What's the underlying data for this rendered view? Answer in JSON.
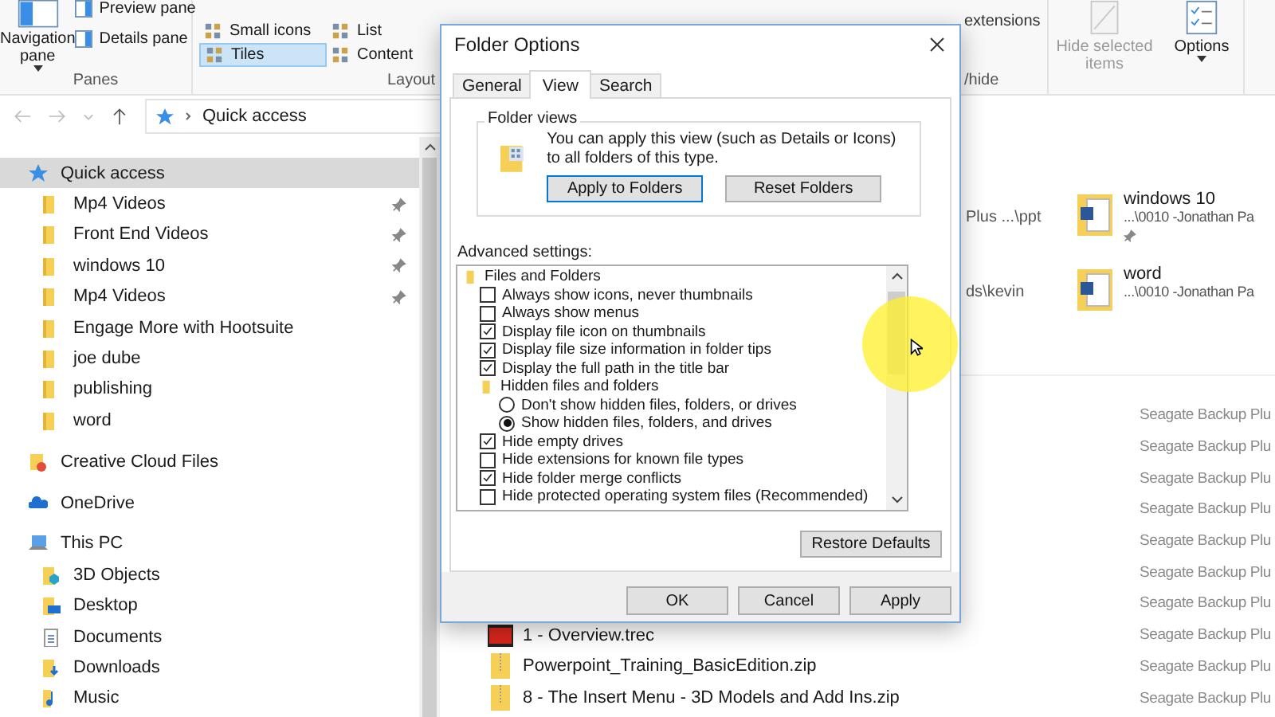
{
  "ribbon": {
    "panes": {
      "label": "Panes",
      "navigation": "Navigation pane",
      "buttons": [
        "Preview pane",
        "Details pane"
      ]
    },
    "layout": {
      "label": "Layout",
      "options": [
        {
          "label": "Small icons",
          "selected": false
        },
        {
          "label": "Tiles",
          "selected": true
        },
        {
          "label": "List",
          "selected": false
        },
        {
          "label": "Content",
          "selected": false
        }
      ]
    },
    "show_hide": {
      "label": "/hide",
      "option": "extensions"
    },
    "hide_selected": "Hide selected items",
    "options": "Options"
  },
  "address": {
    "location": "Quick access"
  },
  "sidebar": {
    "items": [
      {
        "label": "Quick access",
        "kind": "star",
        "selected": true,
        "pinned": false,
        "children": [
          {
            "label": "Mp4 Videos",
            "kind": "folder",
            "selected": false,
            "pinned": true
          },
          {
            "label": "Front End Videos",
            "kind": "folder",
            "selected": false,
            "pinned": true
          },
          {
            "label": "windows 10",
            "kind": "folder",
            "selected": false,
            "pinned": true
          },
          {
            "label": "Mp4 Videos",
            "kind": "folder",
            "selected": false,
            "pinned": true
          },
          {
            "label": "Engage More with Hootsuite",
            "kind": "folder",
            "selected": false,
            "pinned": false
          },
          {
            "label": "joe dube",
            "kind": "folder",
            "selected": false,
            "pinned": false
          },
          {
            "label": "publishing",
            "kind": "folder",
            "selected": false,
            "pinned": false
          },
          {
            "label": "word",
            "kind": "folder",
            "selected": false,
            "pinned": false
          }
        ]
      },
      {
        "label": "Creative Cloud Files",
        "kind": "cloudfiles",
        "selected": false,
        "pinned": false
      },
      {
        "label": "OneDrive",
        "kind": "onedrive",
        "selected": false,
        "pinned": false
      },
      {
        "label": "This PC",
        "kind": "pc",
        "selected": false,
        "pinned": false,
        "children": [
          {
            "label": "3D Objects",
            "kind": "objects3d",
            "selected": false,
            "pinned": false
          },
          {
            "label": "Desktop",
            "kind": "desktop",
            "selected": false,
            "pinned": false
          },
          {
            "label": "Documents",
            "kind": "documents",
            "selected": false,
            "pinned": false
          },
          {
            "label": "Downloads",
            "kind": "downloads",
            "selected": false,
            "pinned": false
          },
          {
            "label": "Music",
            "kind": "music",
            "selected": false,
            "pinned": false
          }
        ]
      }
    ]
  },
  "frequent": [
    {
      "column_1": "Plus ...\\ppt",
      "name": "windows 10",
      "path": "...\\0010 -Jonathan Pa",
      "pinned": true
    },
    {
      "column_1": "ds\\kevin",
      "name": "word",
      "path": "...\\0010 -Jonathan Pa",
      "pinned": false
    }
  ],
  "recent": [
    {
      "path": "Seagate Backup Plu"
    },
    {
      "path": "Seagate Backup Plu"
    },
    {
      "path": "Seagate Backup Plu"
    },
    {
      "path": "Seagate Backup Plu"
    },
    {
      "path": "Seagate Backup Plu"
    },
    {
      "path": "Seagate Backup Plu"
    },
    {
      "path": "Seagate Backup Plu"
    },
    {
      "name": "1 - Overview.trec",
      "kind": "video",
      "path": "Seagate Backup Plu"
    },
    {
      "name": "Powerpoint_Training_BasicEdition.zip",
      "kind": "zip",
      "path": "Seagate Backup Plu"
    },
    {
      "name": "8 - The Insert Menu - 3D Models and Add Ins.zip",
      "kind": "zip",
      "path": "Seagate Backup Plu"
    }
  ],
  "dialog": {
    "title": "Folder Options",
    "tabs": [
      {
        "label": "General",
        "selected": false
      },
      {
        "label": "View",
        "selected": true
      },
      {
        "label": "Search",
        "selected": false
      }
    ],
    "folder_views": {
      "label": "Folder views",
      "text": "You can apply this view (such as Details or Icons) to all folders of this type.",
      "buttons": [
        "Apply to Folders",
        "Reset Folders"
      ]
    },
    "advanced": {
      "label": "Advanced settings:",
      "items": [
        {
          "kind": "folder",
          "label": "Files and Folders",
          "children": [
            {
              "kind": "checkbox",
              "label": "Always show icons, never thumbnails",
              "checked": false
            },
            {
              "kind": "checkbox",
              "label": "Always show menus",
              "checked": false
            },
            {
              "kind": "checkbox",
              "label": "Display file icon on thumbnails",
              "checked": true
            },
            {
              "kind": "checkbox",
              "label": "Display file size information in folder tips",
              "checked": true
            },
            {
              "kind": "checkbox",
              "label": "Display the full path in the title bar",
              "checked": true
            },
            {
              "kind": "folder",
              "label": "Hidden files and folders",
              "children": [
                {
                  "kind": "radio",
                  "label": "Don't show hidden files, folders, or drives",
                  "checked": false
                },
                {
                  "kind": "radio",
                  "label": "Show hidden files, folders, and drives",
                  "checked": true
                }
              ]
            },
            {
              "kind": "checkbox",
              "label": "Hide empty drives",
              "checked": true
            },
            {
              "kind": "checkbox",
              "label": "Hide extensions for known file types",
              "checked": false
            },
            {
              "kind": "checkbox",
              "label": "Hide folder merge conflicts",
              "checked": true
            },
            {
              "kind": "checkbox",
              "label": "Hide protected operating system files (Recommended)",
              "checked": false
            }
          ]
        }
      ]
    },
    "restore": "Restore Defaults",
    "buttons": [
      "OK",
      "Cancel",
      "Apply"
    ]
  }
}
